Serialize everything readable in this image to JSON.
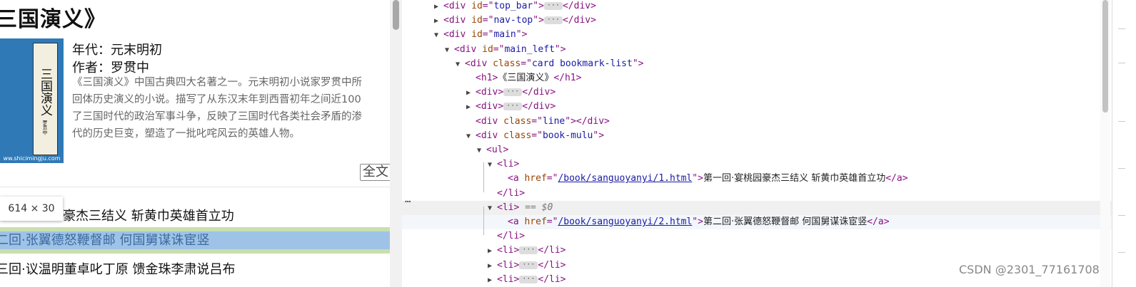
{
  "page": {
    "book_title": "三国演义》",
    "cover": {
      "label_chars": "三国演义",
      "label_small": "罗贯中",
      "url": "ww.shicimingju.com"
    },
    "era": "年代：元末明初",
    "author": "作者：罗贯中",
    "description": "《三国演义》中国古典四大名著之一。元末明初小说家罗贯中所\n回体历史演义的小说。描写了从东汉末年到西晋初年之间近100\n了三国时代的政治军事斗争，反映了三国时代各类社会矛盾的渗\n代的历史巨变，塑造了一批叱咤风云的英雄人物。",
    "full_text_button": "全文",
    "tooltip_size": "614 × 30",
    "chapters": [
      "豪杰三结义 斩黄巾英雄首立功",
      "二回·张翼德怒鞭督邮 何国舅谋诛宦竖",
      "三回·议温明董卓叱丁原 馈金珠李肃说吕布"
    ]
  },
  "devtools": {
    "rows": [
      {
        "indent": 0,
        "tri": "▶",
        "open": "<div id=\"top_bar\">",
        "ell": true,
        "close": "</div>"
      },
      {
        "indent": 0,
        "tri": "▶",
        "open": "<div id=\"nav-top\">",
        "ell": true,
        "close": "</div>"
      },
      {
        "indent": 0,
        "tri": "▼",
        "open": "<div id=\"main\">"
      },
      {
        "indent": 1,
        "tri": "▼",
        "open": "<div id=\"main_left\">"
      },
      {
        "indent": 2,
        "tri": "▼",
        "open": "<div class=\"card bookmark-list\">"
      },
      {
        "indent": 3,
        "tri": "",
        "open": "<h1>",
        "text": "《三国演义》",
        "close": "</h1>"
      },
      {
        "indent": 3,
        "tri": "▶",
        "open": "<div>",
        "ell": true,
        "close": "</div>"
      },
      {
        "indent": 3,
        "tri": "▶",
        "open": "<div>",
        "ell": true,
        "close": "</div>"
      },
      {
        "indent": 3,
        "tri": "",
        "open": "<div class=\"line\">",
        "close": "</div>"
      },
      {
        "indent": 3,
        "tri": "▼",
        "open": "<div class=\"book-mulu\">"
      },
      {
        "indent": 4,
        "tri": "▼",
        "open": "<ul>"
      },
      {
        "indent": 5,
        "tri": "▼",
        "open": "<li>"
      },
      {
        "indent": 6,
        "tri": "",
        "open": "<a href=\"",
        "link": "/book/sanguoyanyi/1.html",
        "open2": "\">",
        "text": "第一回·宴桃园豪杰三结义 斩黄巾英雄首立功",
        "close": "</a>"
      },
      {
        "indent": 5,
        "tri": "",
        "close": "</li>"
      },
      {
        "indent": 5,
        "tri": "▼",
        "open": "<li>",
        "marker": " == $0"
      },
      {
        "indent": 6,
        "tri": "",
        "open": "<a href=\"",
        "link": "/book/sanguoyanyi/2.html",
        "open2": "\">",
        "text": "第二回·张翼德怒鞭督邮 何国舅谋诛宦竖",
        "close": "</a>"
      },
      {
        "indent": 5,
        "tri": "",
        "close": "</li>"
      },
      {
        "indent": 5,
        "tri": "▶",
        "open": "<li>",
        "ell": true,
        "close": "</li>"
      },
      {
        "indent": 5,
        "tri": "▶",
        "open": "<li>",
        "ell": true,
        "close": "</li>"
      },
      {
        "indent": 5,
        "tri": "▶",
        "open": "<li>",
        "ell": true,
        "close": "</li>"
      }
    ],
    "row_more": "…",
    "watermark": "CSDN @2301_77161708"
  },
  "colors": {
    "tag": "#881280",
    "attr_name": "#994500",
    "attr_value": "#1a1aa6",
    "highlight": "#9ec3e6",
    "margin": "#c9dfae"
  },
  "icons": [
    "expand-triangle-icon",
    "collapse-triangle-icon",
    "ellipsis-icon"
  ]
}
